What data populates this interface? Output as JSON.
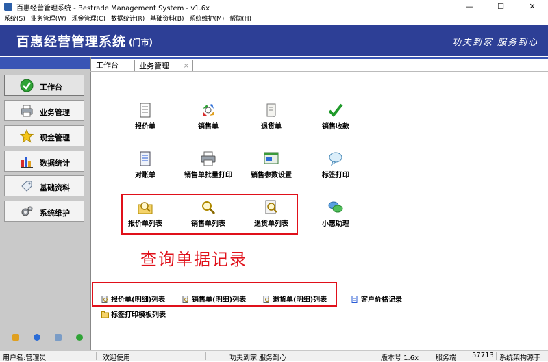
{
  "window": {
    "title": "百惠经营管理系统 - Bestrade Management System - v1.6x",
    "minimize": "—",
    "maximize": "☐",
    "close": "✕"
  },
  "menu": [
    "系统(S)",
    "业务管理(W)",
    "现金管理(C)",
    "数据统计(R)",
    "基础资料(B)",
    "系统维护(M)",
    "帮助(H)"
  ],
  "banner": {
    "title": "百惠经营管理系统",
    "subtitle": "(门市)",
    "slogan": "功夫到家 服务到心",
    "color": "#2d3f96"
  },
  "sidebar": {
    "items": [
      {
        "label": "工作台",
        "icon": "check-circle-icon"
      },
      {
        "label": "业务管理",
        "icon": "printer-icon"
      },
      {
        "label": "现金管理",
        "icon": "star-icon"
      },
      {
        "label": "数据统计",
        "icon": "bar-chart-icon"
      },
      {
        "label": "基础资料",
        "icon": "tag-icon"
      },
      {
        "label": "系统维护",
        "icon": "gears-icon"
      }
    ]
  },
  "tabs": [
    {
      "label": "工作台"
    },
    {
      "label": "业务管理",
      "close": "×"
    }
  ],
  "functions": [
    {
      "label": "报价单",
      "icon": "document-icon"
    },
    {
      "label": "销售单",
      "icon": "recycle-icon"
    },
    {
      "label": "退货单",
      "icon": "scroll-icon"
    },
    {
      "label": "销售收款",
      "icon": "checkmark-icon"
    },
    {
      "label": "对账单",
      "icon": "ledger-icon"
    },
    {
      "label": "销售单批量打印",
      "icon": "printer-icon"
    },
    {
      "label": "销售参数设置",
      "icon": "settings-window-icon"
    },
    {
      "label": "标签打印",
      "icon": "speech-bubble-icon"
    },
    {
      "label": "报价单列表",
      "icon": "folder-search-icon"
    },
    {
      "label": "销售单列表",
      "icon": "magnifier-icon"
    },
    {
      "label": "退货单列表",
      "icon": "doc-search-icon"
    },
    {
      "label": "小惠助理",
      "icon": "chat-icon"
    }
  ],
  "annotation": "查询单据记录",
  "links": [
    {
      "label": "报价单(明细)列表",
      "icon": "doc-search-small-icon"
    },
    {
      "label": "销售单(明细)列表",
      "icon": "doc-search-small-icon"
    },
    {
      "label": "退货单(明细)列表",
      "icon": "doc-search-small-icon"
    },
    {
      "label": "客户价格记录",
      "icon": "doc-edit-small-icon"
    },
    {
      "label": "标签打印模板列表",
      "icon": "folder-small-icon"
    }
  ],
  "status": {
    "user": "用户名:管理员",
    "welcome": "欢迎使用",
    "slogan": "功夫到家 服务到心",
    "version": "版本号 1.6x",
    "server": "服务端",
    "port": "57713",
    "arch": "系统架构源于"
  },
  "colors": {
    "accent": "#3a55b5",
    "annotation": "#e0101a"
  }
}
